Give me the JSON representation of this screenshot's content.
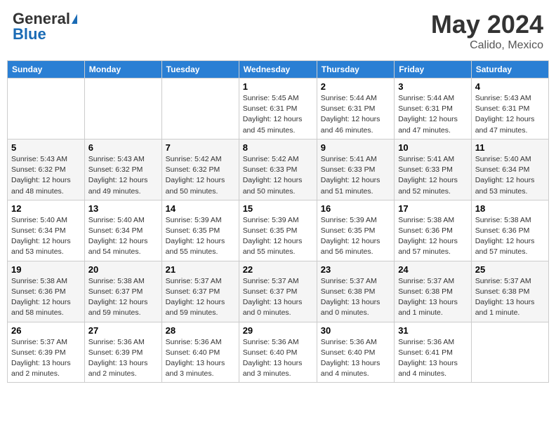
{
  "header": {
    "logo_general": "General",
    "logo_blue": "Blue",
    "month_year": "May 2024",
    "location": "Calido, Mexico"
  },
  "days_of_week": [
    "Sunday",
    "Monday",
    "Tuesday",
    "Wednesday",
    "Thursday",
    "Friday",
    "Saturday"
  ],
  "weeks": [
    {
      "row_class": "row-normal",
      "days": [
        {
          "number": "",
          "info": ""
        },
        {
          "number": "",
          "info": ""
        },
        {
          "number": "",
          "info": ""
        },
        {
          "number": "1",
          "info": "Sunrise: 5:45 AM\nSunset: 6:31 PM\nDaylight: 12 hours\nand 45 minutes."
        },
        {
          "number": "2",
          "info": "Sunrise: 5:44 AM\nSunset: 6:31 PM\nDaylight: 12 hours\nand 46 minutes."
        },
        {
          "number": "3",
          "info": "Sunrise: 5:44 AM\nSunset: 6:31 PM\nDaylight: 12 hours\nand 47 minutes."
        },
        {
          "number": "4",
          "info": "Sunrise: 5:43 AM\nSunset: 6:31 PM\nDaylight: 12 hours\nand 47 minutes."
        }
      ]
    },
    {
      "row_class": "row-alt",
      "days": [
        {
          "number": "5",
          "info": "Sunrise: 5:43 AM\nSunset: 6:32 PM\nDaylight: 12 hours\nand 48 minutes."
        },
        {
          "number": "6",
          "info": "Sunrise: 5:43 AM\nSunset: 6:32 PM\nDaylight: 12 hours\nand 49 minutes."
        },
        {
          "number": "7",
          "info": "Sunrise: 5:42 AM\nSunset: 6:32 PM\nDaylight: 12 hours\nand 50 minutes."
        },
        {
          "number": "8",
          "info": "Sunrise: 5:42 AM\nSunset: 6:33 PM\nDaylight: 12 hours\nand 50 minutes."
        },
        {
          "number": "9",
          "info": "Sunrise: 5:41 AM\nSunset: 6:33 PM\nDaylight: 12 hours\nand 51 minutes."
        },
        {
          "number": "10",
          "info": "Sunrise: 5:41 AM\nSunset: 6:33 PM\nDaylight: 12 hours\nand 52 minutes."
        },
        {
          "number": "11",
          "info": "Sunrise: 5:40 AM\nSunset: 6:34 PM\nDaylight: 12 hours\nand 53 minutes."
        }
      ]
    },
    {
      "row_class": "row-normal",
      "days": [
        {
          "number": "12",
          "info": "Sunrise: 5:40 AM\nSunset: 6:34 PM\nDaylight: 12 hours\nand 53 minutes."
        },
        {
          "number": "13",
          "info": "Sunrise: 5:40 AM\nSunset: 6:34 PM\nDaylight: 12 hours\nand 54 minutes."
        },
        {
          "number": "14",
          "info": "Sunrise: 5:39 AM\nSunset: 6:35 PM\nDaylight: 12 hours\nand 55 minutes."
        },
        {
          "number": "15",
          "info": "Sunrise: 5:39 AM\nSunset: 6:35 PM\nDaylight: 12 hours\nand 55 minutes."
        },
        {
          "number": "16",
          "info": "Sunrise: 5:39 AM\nSunset: 6:35 PM\nDaylight: 12 hours\nand 56 minutes."
        },
        {
          "number": "17",
          "info": "Sunrise: 5:38 AM\nSunset: 6:36 PM\nDaylight: 12 hours\nand 57 minutes."
        },
        {
          "number": "18",
          "info": "Sunrise: 5:38 AM\nSunset: 6:36 PM\nDaylight: 12 hours\nand 57 minutes."
        }
      ]
    },
    {
      "row_class": "row-alt",
      "days": [
        {
          "number": "19",
          "info": "Sunrise: 5:38 AM\nSunset: 6:36 PM\nDaylight: 12 hours\nand 58 minutes."
        },
        {
          "number": "20",
          "info": "Sunrise: 5:38 AM\nSunset: 6:37 PM\nDaylight: 12 hours\nand 59 minutes."
        },
        {
          "number": "21",
          "info": "Sunrise: 5:37 AM\nSunset: 6:37 PM\nDaylight: 12 hours\nand 59 minutes."
        },
        {
          "number": "22",
          "info": "Sunrise: 5:37 AM\nSunset: 6:37 PM\nDaylight: 13 hours\nand 0 minutes."
        },
        {
          "number": "23",
          "info": "Sunrise: 5:37 AM\nSunset: 6:38 PM\nDaylight: 13 hours\nand 0 minutes."
        },
        {
          "number": "24",
          "info": "Sunrise: 5:37 AM\nSunset: 6:38 PM\nDaylight: 13 hours\nand 1 minute."
        },
        {
          "number": "25",
          "info": "Sunrise: 5:37 AM\nSunset: 6:38 PM\nDaylight: 13 hours\nand 1 minute."
        }
      ]
    },
    {
      "row_class": "row-normal",
      "days": [
        {
          "number": "26",
          "info": "Sunrise: 5:37 AM\nSunset: 6:39 PM\nDaylight: 13 hours\nand 2 minutes."
        },
        {
          "number": "27",
          "info": "Sunrise: 5:36 AM\nSunset: 6:39 PM\nDaylight: 13 hours\nand 2 minutes."
        },
        {
          "number": "28",
          "info": "Sunrise: 5:36 AM\nSunset: 6:40 PM\nDaylight: 13 hours\nand 3 minutes."
        },
        {
          "number": "29",
          "info": "Sunrise: 5:36 AM\nSunset: 6:40 PM\nDaylight: 13 hours\nand 3 minutes."
        },
        {
          "number": "30",
          "info": "Sunrise: 5:36 AM\nSunset: 6:40 PM\nDaylight: 13 hours\nand 4 minutes."
        },
        {
          "number": "31",
          "info": "Sunrise: 5:36 AM\nSunset: 6:41 PM\nDaylight: 13 hours\nand 4 minutes."
        },
        {
          "number": "",
          "info": ""
        }
      ]
    }
  ]
}
